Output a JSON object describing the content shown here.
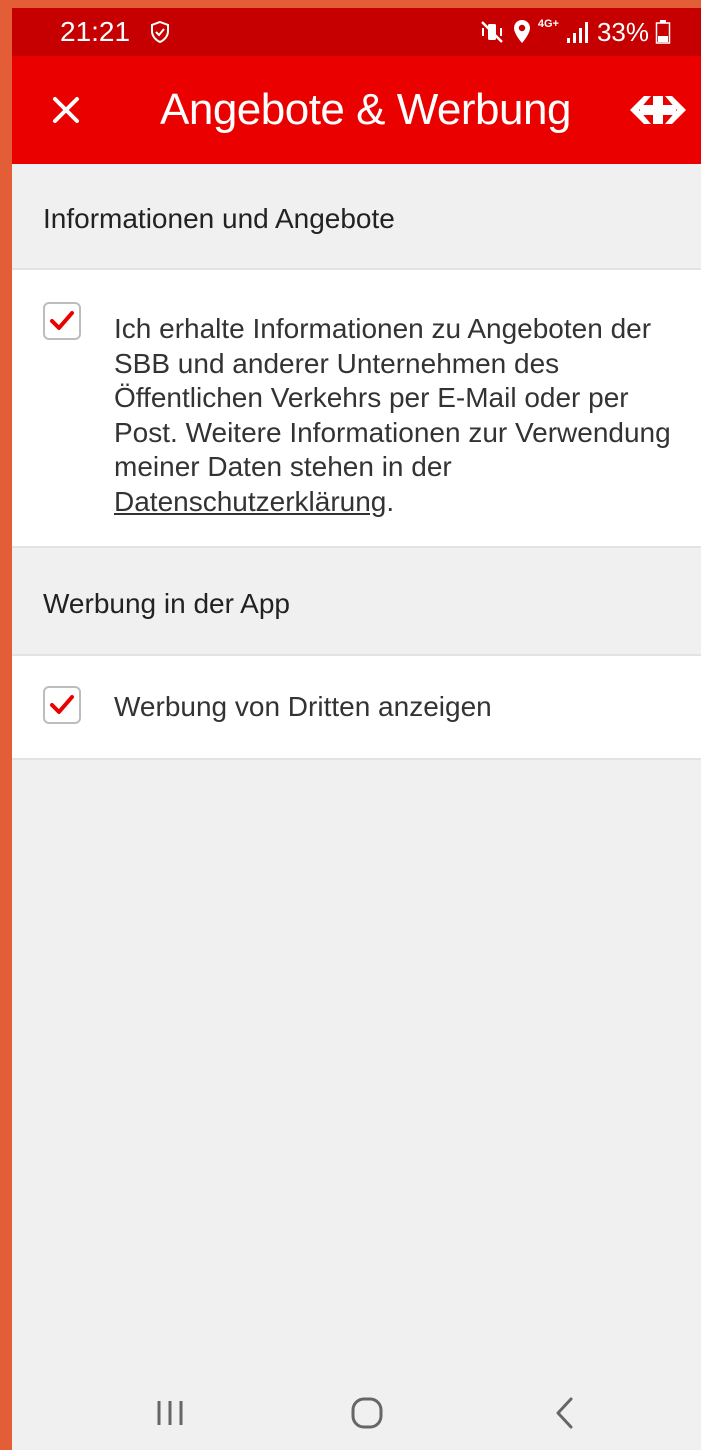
{
  "status_bar": {
    "time": "21:21",
    "battery": "33%",
    "network": "4G+"
  },
  "app_bar": {
    "close_icon": "close-icon",
    "title": "Angebote & Werbung",
    "logo_icon": "sbb-logo-icon"
  },
  "sections": [
    {
      "header": "Informationen und Angebote",
      "checkbox_checked": true,
      "text_before_link": "Ich erhalte Informationen zu Angeboten der SBB und anderer Unternehmen des Öffentlichen Verkehrs per E-Mail oder per Post. Weitere Informationen zur Verwendung meiner Daten stehen in der ",
      "link_text": "Datenschutzerklärung",
      "text_after_link": "."
    },
    {
      "header": "Werbung in der App",
      "checkbox_checked": true,
      "label": "Werbung von Dritten anzeigen"
    }
  ],
  "nav_bar": {
    "recents_icon": "recents-icon",
    "home_icon": "home-icon",
    "back_icon": "back-icon"
  },
  "colors": {
    "status_bar": "#c60000",
    "app_bar": "#eb0000",
    "checkmark": "#eb0000",
    "background": "#f0f0f0",
    "card": "#ffffff"
  }
}
